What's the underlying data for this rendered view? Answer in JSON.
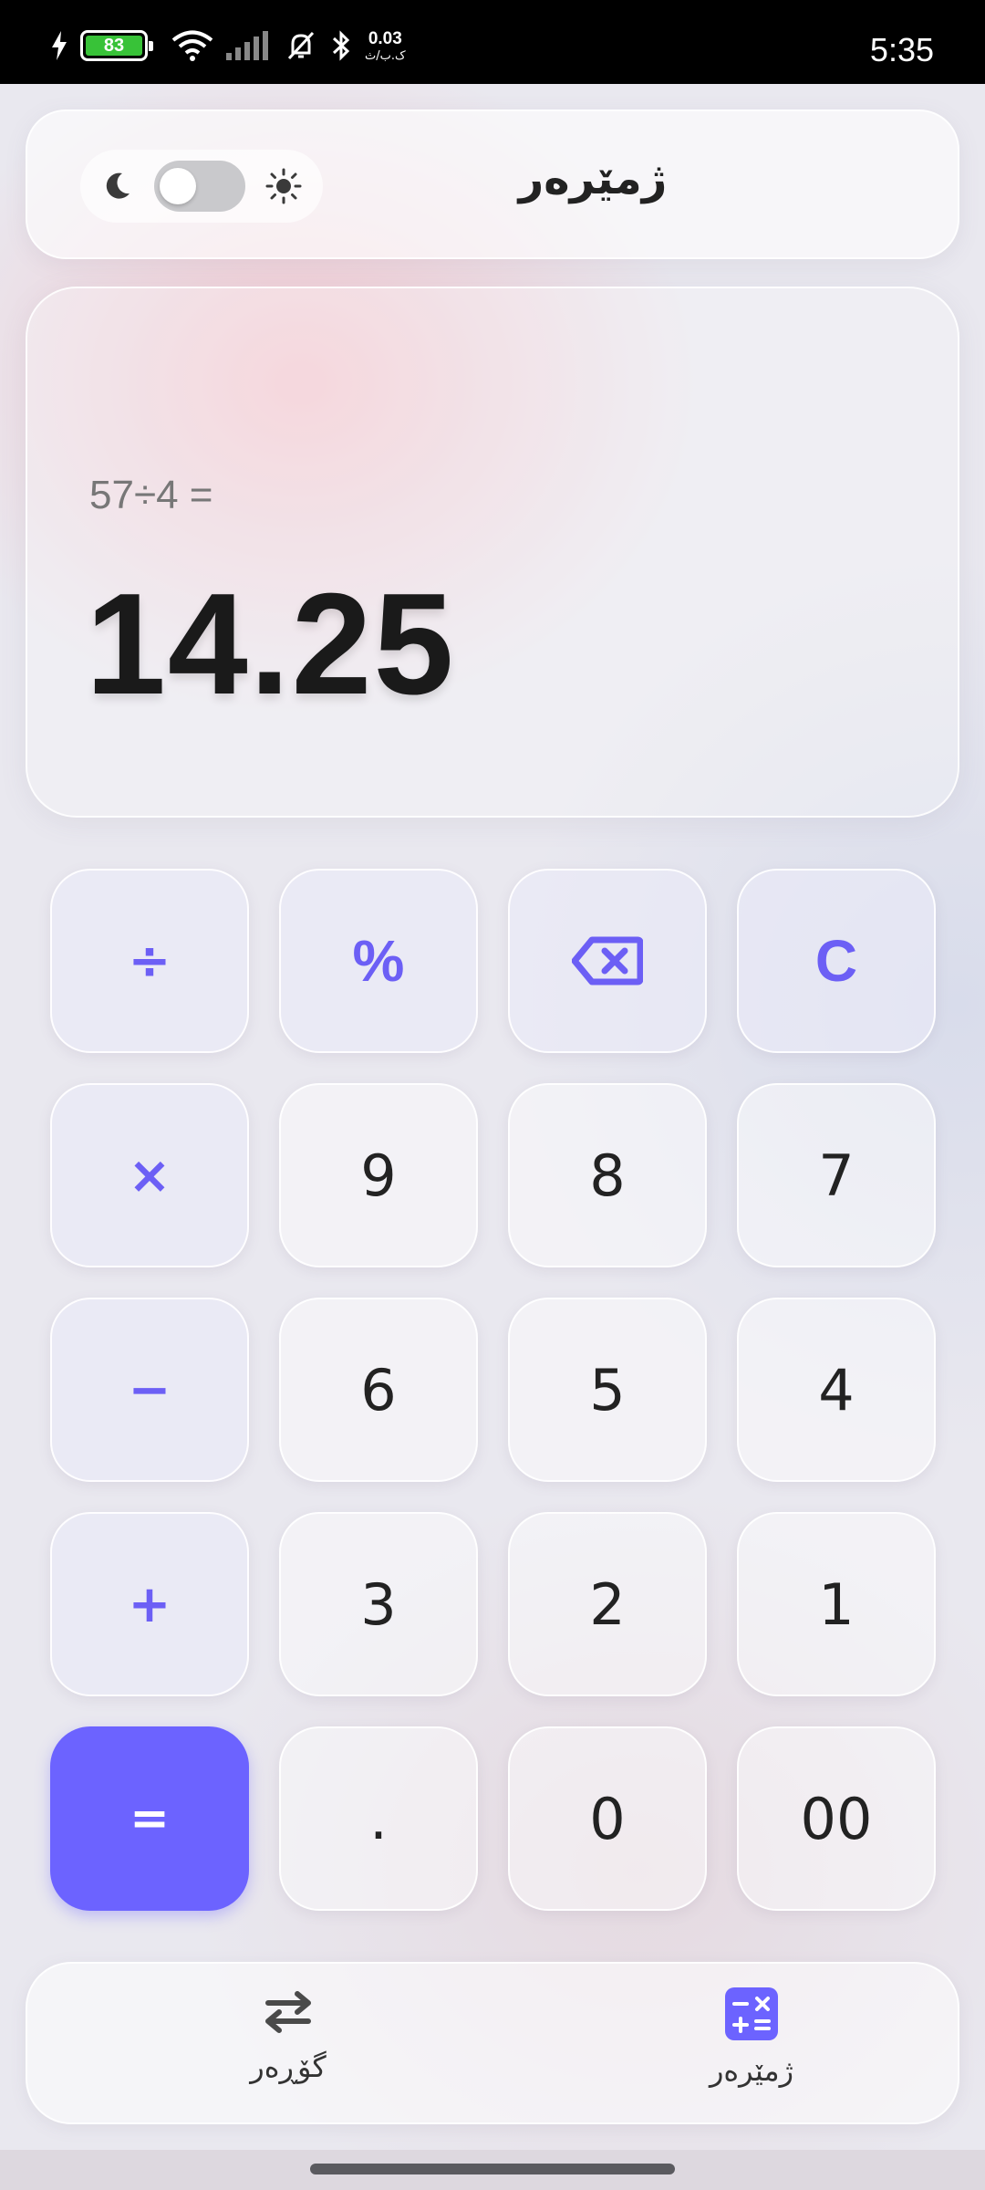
{
  "status_bar": {
    "battery_level": "83",
    "network_speed_value": "0.03",
    "network_speed_unit": "ک.ب/ث",
    "time": "5:35"
  },
  "header": {
    "title": "ژمێرەر",
    "theme_toggle": {
      "state": "off",
      "left_icon": "moon-icon",
      "right_icon": "sun-icon"
    }
  },
  "display": {
    "expression": "57÷4 =",
    "result": "14.25"
  },
  "keypad": {
    "rows": [
      [
        {
          "label": "÷",
          "kind": "op"
        },
        {
          "label": "%",
          "kind": "fn"
        },
        {
          "label": "",
          "kind": "backspace",
          "icon": "backspace-icon"
        },
        {
          "label": "C",
          "kind": "fn"
        }
      ],
      [
        {
          "label": "×",
          "kind": "op"
        },
        {
          "label": "9",
          "kind": "num"
        },
        {
          "label": "8",
          "kind": "num"
        },
        {
          "label": "7",
          "kind": "num"
        }
      ],
      [
        {
          "label": "−",
          "kind": "op"
        },
        {
          "label": "6",
          "kind": "num"
        },
        {
          "label": "5",
          "kind": "num"
        },
        {
          "label": "4",
          "kind": "num"
        }
      ],
      [
        {
          "label": "+",
          "kind": "op"
        },
        {
          "label": "3",
          "kind": "num"
        },
        {
          "label": "2",
          "kind": "num"
        },
        {
          "label": "1",
          "kind": "num"
        }
      ],
      [
        {
          "label": "=",
          "kind": "eq"
        },
        {
          "label": ".",
          "kind": "num"
        },
        {
          "label": "0",
          "kind": "num"
        },
        {
          "label": "00",
          "kind": "num"
        }
      ]
    ]
  },
  "bottom_nav": {
    "items": [
      {
        "label": "گۆڕەر",
        "icon": "swap-arrows-icon",
        "active": false
      },
      {
        "label": "ژمێرەر",
        "icon": "calculator-icon",
        "active": true
      }
    ]
  },
  "colors": {
    "accent": "#6c63ff",
    "text_dark": "#1a1a1a",
    "expression_gray": "#777777"
  }
}
